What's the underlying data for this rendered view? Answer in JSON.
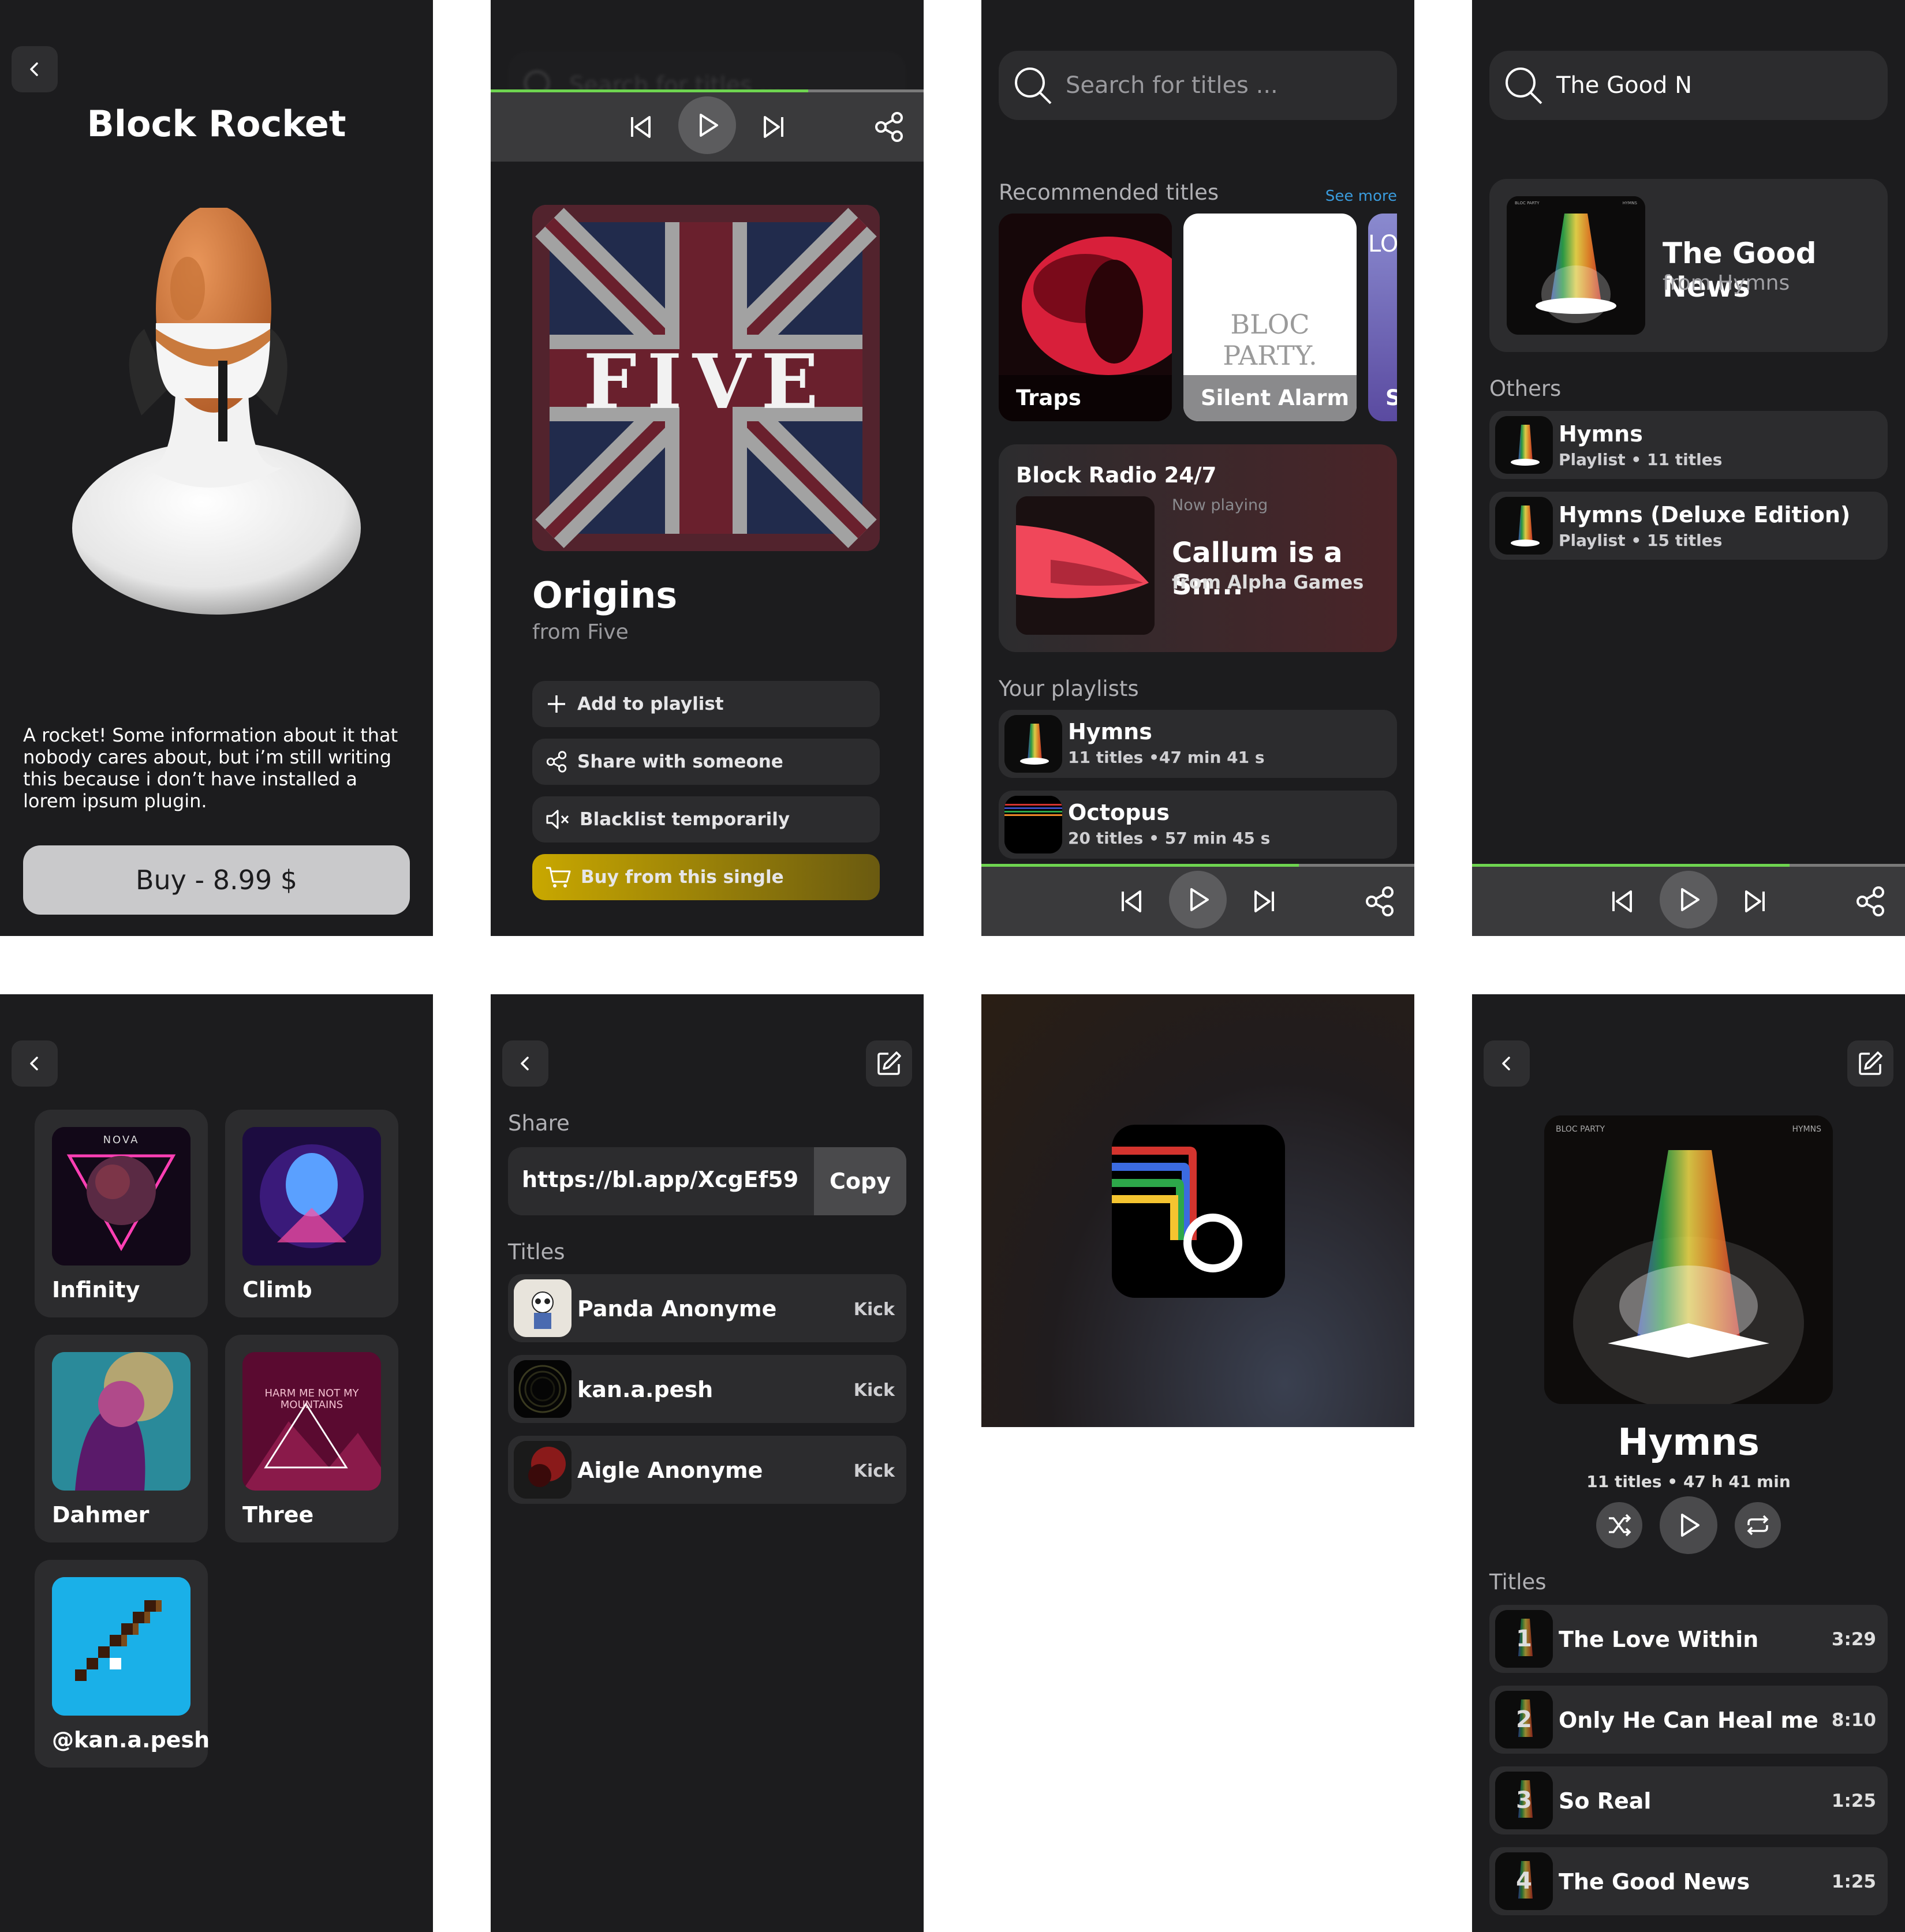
{
  "accent": {
    "progress": "#6ed450",
    "buy_gradient_from": "#c9a800",
    "buy_gradient_to": "#6a5a10"
  },
  "rocket_screen": {
    "title": "Block Rocket",
    "description": "A rocket! Some information about it that nobody cares about, but i’m still writing this because i don’t have installed a lorem ipsum plugin.",
    "buy_label": "Buy - 8.99 $"
  },
  "single_screen": {
    "search_placeholder": "Search for titles ...",
    "cover_text": "FIVE",
    "title": "Origins",
    "subtitle": "from Five",
    "actions": [
      {
        "label": "Add to playlist",
        "icon": "plus-icon"
      },
      {
        "label": "Share with someone",
        "icon": "share-icon"
      },
      {
        "label": "Blacklist temporarily",
        "icon": "mute-icon"
      },
      {
        "label": "Buy from this single",
        "icon": "cart-icon"
      }
    ]
  },
  "home_screen": {
    "search_placeholder": "Search for titles ...",
    "recommended_label": "Recommended titles",
    "see_more": "See more",
    "recommended": [
      {
        "title": "Traps"
      },
      {
        "title": "Silent Alarm",
        "cover_text": "BLOC PARTY."
      },
      {
        "title": "S",
        "cover_text": "LO"
      }
    ],
    "radio": {
      "title": "Block Radio 24/7",
      "now_playing": "Now playing",
      "track": "Callum is a Sn...",
      "artist": "from Alpha Games"
    },
    "playlists_label": "Your playlists",
    "playlists": [
      {
        "name": "Hymns",
        "meta": "11 titles •47 min 41 s"
      },
      {
        "name": "Octopus",
        "meta": "20 titles • 57 min 45 s"
      }
    ]
  },
  "search_screen": {
    "query": "The Good N",
    "top_result": {
      "title": "The Good News",
      "subtitle": "from Hymns",
      "cover_left": "BLOC PARTY",
      "cover_right": "HYMNS"
    },
    "others_label": "Others",
    "others": [
      {
        "name": "Hymns",
        "meta": "Playlist • 11 titles"
      },
      {
        "name": "Hymns (Deluxe Edition)",
        "meta": "Playlist • 15 titles"
      }
    ]
  },
  "collection_screen": {
    "items": [
      {
        "name": "Infinity",
        "cover_text": "NOVA"
      },
      {
        "name": "Climb"
      },
      {
        "name": "Dahmer"
      },
      {
        "name": "Three",
        "cover_text": "HARM ME NOT MY MOUNTAINS"
      },
      {
        "name": "@kan.a.pesh"
      }
    ]
  },
  "share_screen": {
    "share_label": "Share",
    "link": "https://bl.app/XcgEf59",
    "copy_label": "Copy",
    "titles_label": "Titles",
    "users": [
      {
        "name": "Panda Anonyme",
        "action": "Kick"
      },
      {
        "name": "kan.a.pesh",
        "action": "Kick"
      },
      {
        "name": "Aigle Anonyme",
        "action": "Kick"
      }
    ]
  },
  "splash_screen": {
    "logo": "b"
  },
  "playlist_screen": {
    "title": "Hymns",
    "meta": "11 titles • 47 h 41 min",
    "cover_left": "BLOC PARTY",
    "cover_right": "HYMNS",
    "titles_label": "Titles",
    "tracks": [
      {
        "num": "1",
        "name": "The Love Within",
        "duration": "3:29"
      },
      {
        "num": "2",
        "name": "Only He Can Heal me",
        "duration": "8:10"
      },
      {
        "num": "3",
        "name": "So Real",
        "duration": "1:25"
      },
      {
        "num": "4",
        "name": "The Good News",
        "duration": "1:25"
      }
    ]
  }
}
